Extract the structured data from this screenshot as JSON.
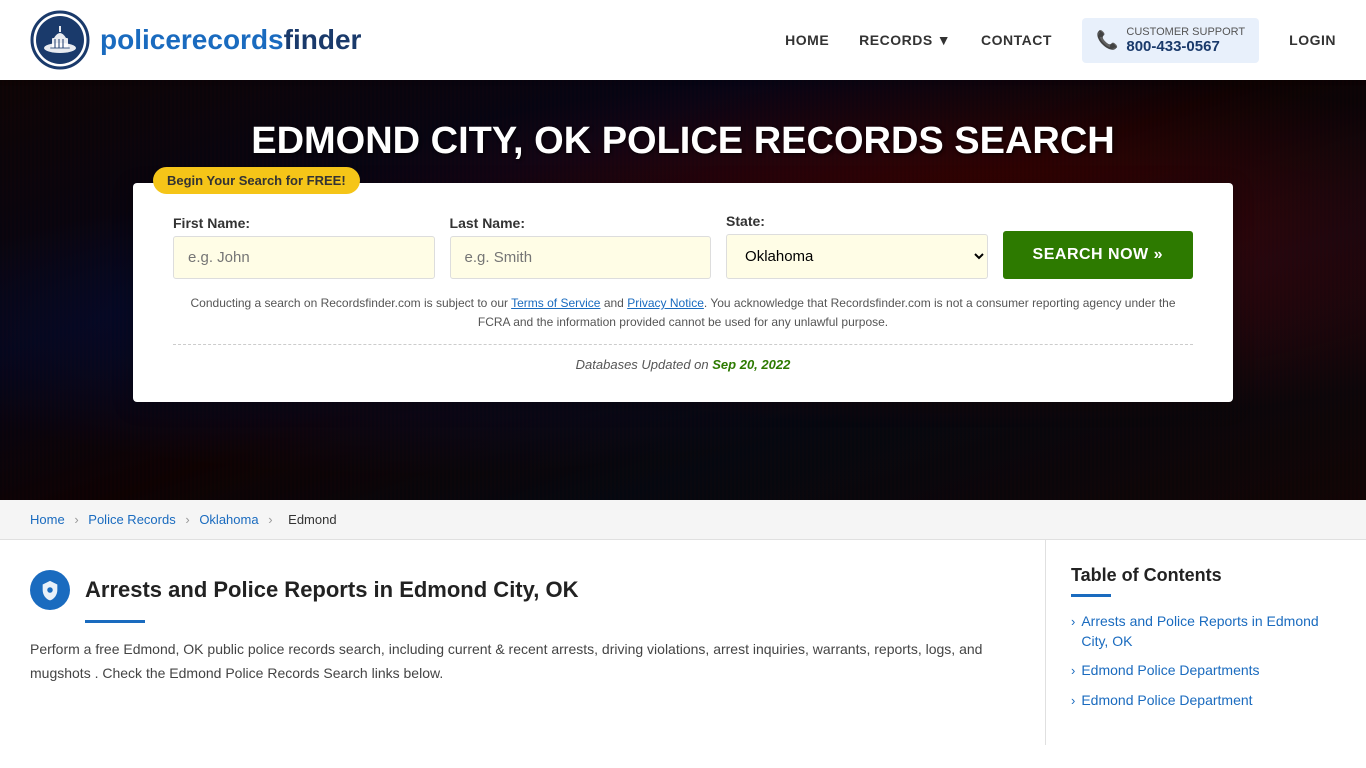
{
  "header": {
    "logo_text_regular": "policerecords",
    "logo_text_bold": "finder",
    "nav": {
      "home": "HOME",
      "records": "RECORDS",
      "contact": "CONTACT",
      "login": "LOGIN"
    },
    "customer_support": {
      "label": "CUSTOMER SUPPORT",
      "phone": "800-433-0567"
    }
  },
  "hero": {
    "title": "EDMOND CITY, OK POLICE RECORDS SEARCH",
    "badge": "Begin Your Search for FREE!"
  },
  "search_form": {
    "first_name_label": "First Name:",
    "first_name_placeholder": "e.g. John",
    "last_name_label": "Last Name:",
    "last_name_placeholder": "e.g. Smith",
    "state_label": "State:",
    "state_value": "Oklahoma",
    "search_button": "SEARCH NOW »",
    "disclaimer": "Conducting a search on Recordsfinder.com is subject to our Terms of Service and Privacy Notice. You acknowledge that Recordsfinder.com is not a consumer reporting agency under the FCRA and the information provided cannot be used for any unlawful purpose.",
    "db_updated_prefix": "Databases Updated on",
    "db_updated_date": "Sep 20, 2022"
  },
  "breadcrumb": {
    "home": "Home",
    "police_records": "Police Records",
    "oklahoma": "Oklahoma",
    "current": "Edmond"
  },
  "main_section": {
    "title": "Arrests and Police Reports in Edmond City, OK",
    "body": "Perform a free Edmond, OK public police records search, including current & recent arrests, driving violations, arrest inquiries, warrants, reports, logs, and mugshots . Check the Edmond Police Records Search links below."
  },
  "toc": {
    "title": "Table of Contents",
    "items": [
      {
        "label": "Arrests and Police Reports in Edmond City, OK"
      },
      {
        "label": "Edmond Police Departments"
      },
      {
        "label": "Edmond Police Department"
      }
    ]
  }
}
